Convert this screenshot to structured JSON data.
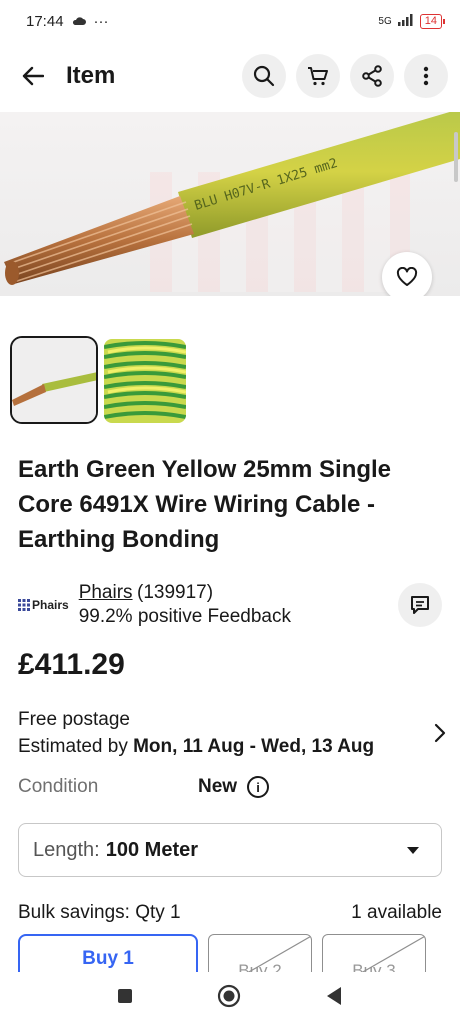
{
  "status_bar": {
    "time": "17:44",
    "network": "5G",
    "battery": "14"
  },
  "app_bar": {
    "title": "Item"
  },
  "item": {
    "title": "Earth Green Yellow 25mm Single Core 6491X Wire Wiring Cable - Earthing Bonding",
    "price": "£411.29"
  },
  "hero_image": {
    "cable_print": "BLU  H07V-R  1X25 mm2"
  },
  "seller": {
    "logo_text": "Phairs",
    "name": "Phairs",
    "feedback_count": "(139917)",
    "feedback": "99.2% positive Feedback"
  },
  "postage": {
    "line1": "Free postage",
    "estimated_prefix": "Estimated by ",
    "estimated_dates": "Mon, 11 Aug - Wed, 13 Aug"
  },
  "condition": {
    "label": "Condition",
    "value": "New"
  },
  "length": {
    "label": "Length:",
    "value": "100 Meter"
  },
  "bulk": {
    "label": "Bulk savings: Qty 1",
    "available": "1 available",
    "options": [
      "Buy 1",
      "Buy 2",
      "Buy 3"
    ]
  },
  "colors": {
    "accent": "#3665f3",
    "text": "#191919",
    "secondary": "#707070"
  }
}
